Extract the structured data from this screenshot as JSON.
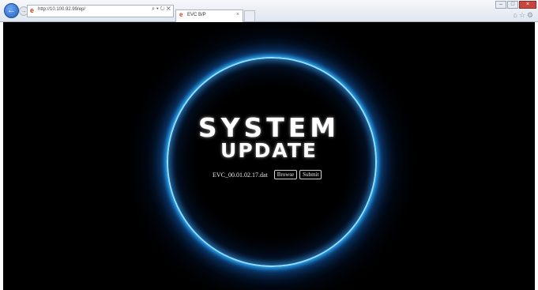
{
  "browser": {
    "url": "http://10.100.92.99/ep/",
    "address_tools": "⌕ ▾ ↻ ✕",
    "tab_title": "EVC B/P",
    "tab_close": "×"
  },
  "page": {
    "title_line1": "SYSTEM",
    "title_line2": "UPDATE",
    "file_name": "EVC_00.01.02.17.dat",
    "browse_label": "Browse",
    "submit_label": "Submit"
  },
  "colors": {
    "ring": "#2fb4ff",
    "background": "#000000"
  }
}
